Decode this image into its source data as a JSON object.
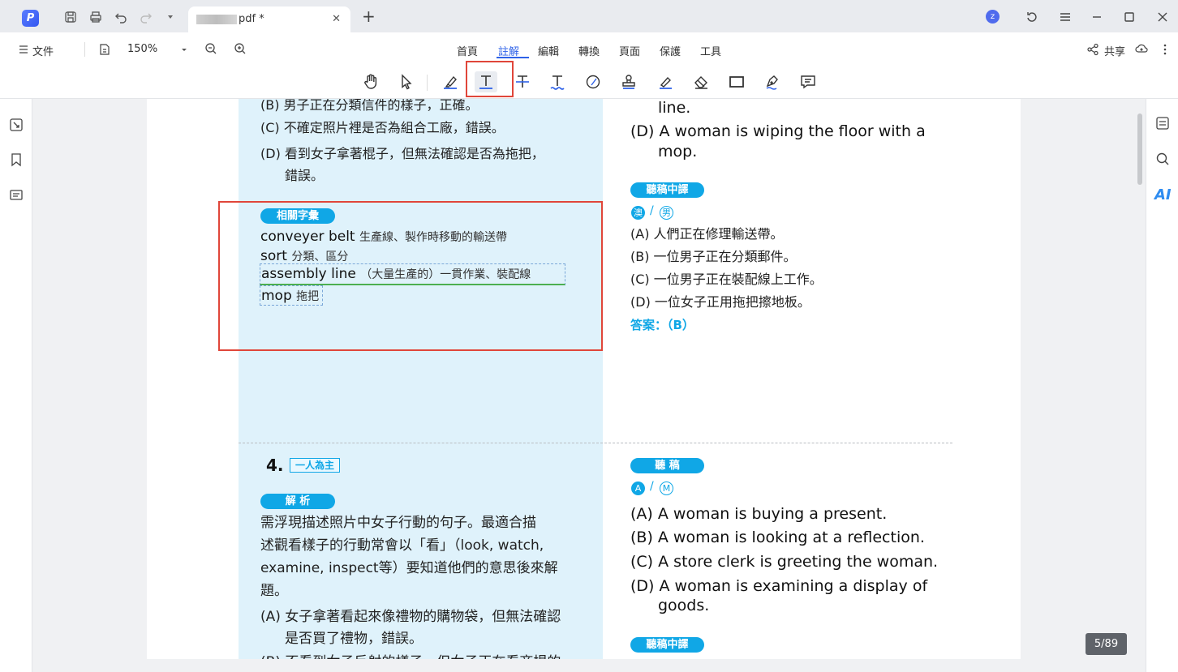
{
  "titlebar": {
    "app_logo": "P",
    "tab_title": "pdf *",
    "tab_close": "✕",
    "new_tab": "+",
    "user_initial": "z"
  },
  "menubar": {
    "file_menu": "文件",
    "zoom": "150%",
    "tabs": [
      "首頁",
      "註解",
      "編輯",
      "轉換",
      "頁面",
      "保護",
      "工具"
    ],
    "active_tab": "註解",
    "share": "共享"
  },
  "toolbar": {
    "tools": [
      "hand-tool",
      "select-tool",
      "highlight-tool",
      "textbox-tool",
      "strikethrough-tool",
      "underline-tool",
      "shape-tool",
      "stamp-tool",
      "pen-tool",
      "eraser-tool",
      "rectangle-tool",
      "signature-tool",
      "comment-tool"
    ],
    "selected_tool": "textbox-tool"
  },
  "right_rail": {
    "ai_label": "AI"
  },
  "document": {
    "top_left": {
      "b": "(B) 男子正在分類信件的樣子，正確。",
      "c": "(C) 不確定照片裡是否為組合工廠，錯誤。",
      "d1": "(D) 看到女子拿著棍子，但無法確認是否為拖把，",
      "d2": "錯誤。"
    },
    "vocab": {
      "title": "相關字彙",
      "items": [
        {
          "en": "conveyer belt",
          "zh": "生產線、製作時移動的輸送帶"
        },
        {
          "en": "sort",
          "zh": "分類、區分"
        },
        {
          "en": "assembly line",
          "zh": "（大量生產的）一貫作業、裝配線"
        },
        {
          "en": "mop",
          "zh": "拖把"
        }
      ]
    },
    "top_right": {
      "line_tail": "line.",
      "d1": "(D) A woman is wiping the floor with a",
      "d2": "mop.",
      "pill": "聽稿中譯",
      "c1": "澳",
      "c2": "男",
      "sep": "/",
      "a": "(A) 人們正在修理輸送帶。",
      "b": "(B) 一位男子正在分類郵件。",
      "c": "(C) 一位男子正在裝配線上工作。",
      "d": "(D) 一位女子正用拖把擦地板。",
      "answer": "答案：（B）"
    },
    "q4": {
      "number": "4.",
      "tag": "一人為主",
      "pill": "解 析",
      "p1": "需浮現描述照片中女子行動的句子。最適合描",
      "p2": "述觀看樣子的行動常會以「看」（look, watch,",
      "p3": "examine, inspect等）要知道他們的意思後來解",
      "p4": "題。",
      "a1": "(A) 女子拿著看起來像禮物的購物袋，但無法確認",
      "a2": "是否買了禮物，錯誤。",
      "b_partial": "(B) 不看到女子反射的樣子，但女子正在看商場的"
    },
    "q4_right": {
      "pill": "聽 稿",
      "c1": "A",
      "c2": "M",
      "sep": "/",
      "a": "(A) A woman is buying a present.",
      "b": "(B) A woman is looking at a reflection.",
      "c": "(C) A store clerk is greeting the woman.",
      "d1": "(D) A woman is examining a display of",
      "d2": "goods.",
      "pill2": "聽稿中譯"
    }
  },
  "page_counter": "5/89",
  "colors": {
    "accent": "#2f62e8",
    "highlight_frame": "#e0463a",
    "pill": "#10a7e6",
    "column_bg": "#dff2fb"
  }
}
